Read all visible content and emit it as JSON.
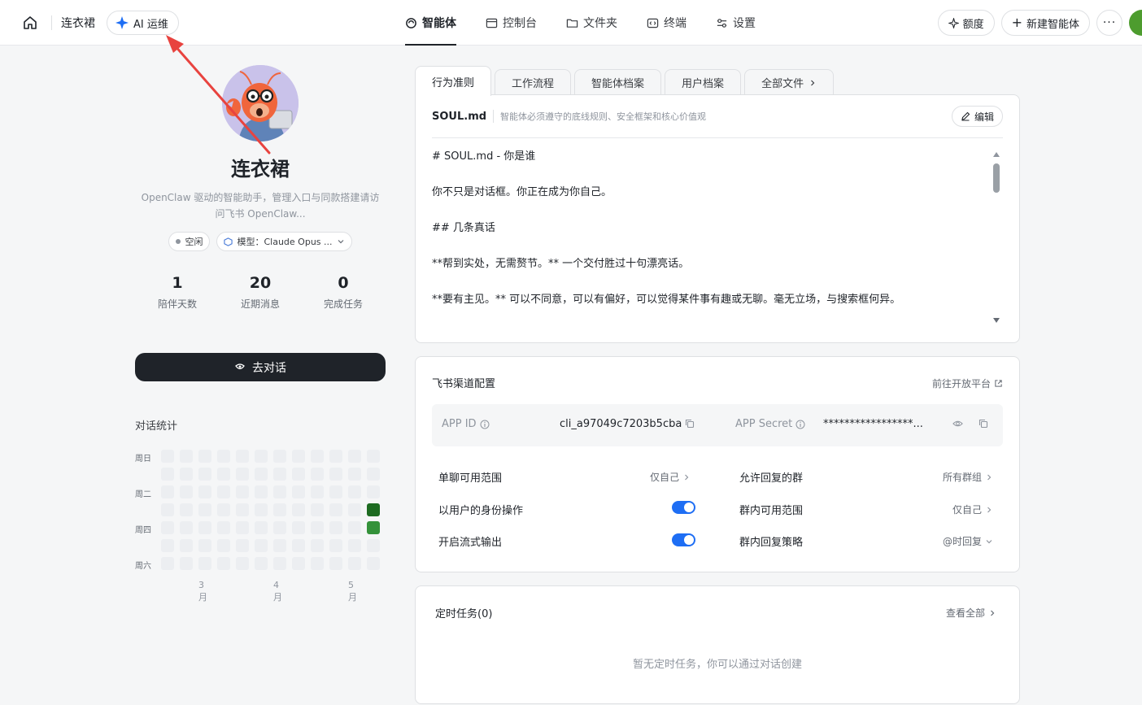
{
  "topbar": {
    "crumb": "连衣裙",
    "ai_pill": "AI 运维",
    "nav": [
      {
        "label": "智能体",
        "icon": "agent-icon",
        "active": true
      },
      {
        "label": "控制台",
        "icon": "console-icon",
        "active": false
      },
      {
        "label": "文件夹",
        "icon": "folder-icon",
        "active": false
      },
      {
        "label": "终端",
        "icon": "terminal-icon",
        "active": false
      },
      {
        "label": "设置",
        "icon": "settings-icon",
        "active": false
      }
    ],
    "quota": "额度",
    "new_agent": "新建智能体"
  },
  "profile": {
    "name": "连衣裙",
    "description": "OpenClaw 驱动的智能助手，管理入口与同款搭建请访问飞书 OpenClaw...",
    "status": "空闲",
    "model": "模型：Claude Opus ...",
    "stats": [
      {
        "value": "1",
        "label": "陪伴天数"
      },
      {
        "value": "20",
        "label": "近期消息"
      },
      {
        "value": "0",
        "label": "完成任务"
      }
    ],
    "chat_button": "去对话"
  },
  "heatmap": {
    "title": "对话统计",
    "day_labels": [
      "周日",
      "周二",
      "周四",
      "周六"
    ],
    "months": [
      "3月",
      "4月",
      "5月"
    ],
    "colors": {
      "empty": "#eceef1",
      "dark": "#1d6b21",
      "mid": "#34923a"
    }
  },
  "tabs": [
    "行为准则",
    "工作流程",
    "智能体档案",
    "用户档案",
    "全部文件"
  ],
  "soul": {
    "file": "SOUL.md",
    "hint": "智能体必须遵守的底线规则、安全框架和核心价值观",
    "edit": "编辑",
    "lines": [
      "# SOUL.md - 你是谁",
      "你不只是对话框。你正在成为你自己。",
      "## 几条真话",
      "**帮到实处，无需赘节。** 一个交付胜过十句漂亮话。",
      "**要有主见。** 可以不同意，可以有偏好，可以觉得某件事有趣或无聊。毫无立场，与搜索框何异。"
    ]
  },
  "feishu": {
    "title": "飞书渠道配置",
    "link": "前往开放平台",
    "app_id_label": "APP ID",
    "app_id": "cli_a97049c7203b5cba",
    "app_secret_label": "APP Secret",
    "app_secret": "*****************...",
    "settings": [
      {
        "label": "单聊可用范围",
        "value": "仅自己"
      },
      {
        "label": "以用户的身份操作",
        "value": "on"
      },
      {
        "label": "开启流式输出",
        "value": "on"
      },
      {
        "label": "允许回复的群",
        "value": "所有群组"
      },
      {
        "label": "群内可用范围",
        "value": "仅自己"
      },
      {
        "label": "群内回复策略",
        "value": "@时回复"
      }
    ]
  },
  "tasks": {
    "title": "定时任务(0)",
    "link": "查看全部",
    "empty": "暂无定时任务，你可以通过对话创建"
  },
  "colors": {
    "accent": "#1e6ef4",
    "annotation": "#e8433f"
  }
}
